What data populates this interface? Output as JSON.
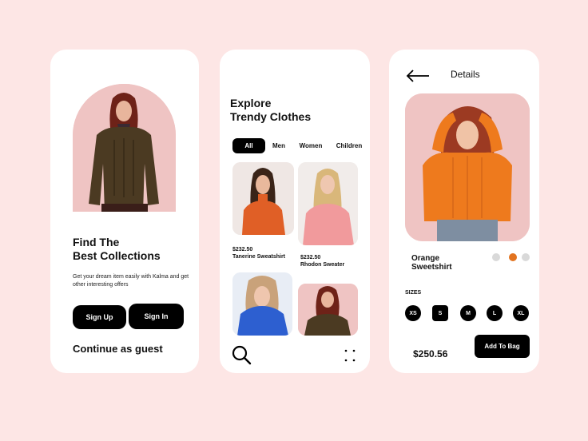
{
  "welcome": {
    "title_line1": "Find The",
    "title_line2": "Best Collections",
    "description": "Get your dream item easily with Kalma and get other interesting offers",
    "sign_up_label": "Sign Up",
    "sign_in_label": "Sign In",
    "guest_label": "Continue as guest"
  },
  "explore": {
    "title_line1": "Explore",
    "title_line2": "Trendy Clothes",
    "tabs": [
      {
        "label": "All",
        "active": true
      },
      {
        "label": "Men",
        "active": false
      },
      {
        "label": "Women",
        "active": false
      },
      {
        "label": "Children",
        "active": false
      }
    ],
    "products": [
      {
        "price": "$232.50",
        "name": "Tanerine Sweatshirt"
      },
      {
        "price": "$232.50",
        "name": "Rhodon Sweater"
      }
    ],
    "bottom_nav": {
      "search_icon": "search-icon",
      "menu_icon": "grid-dots-icon"
    }
  },
  "details": {
    "header": "Details",
    "back_icon": "arrow-left-icon",
    "product_name_line1": "Orange",
    "product_name_line2": "Sweetshirt",
    "colors": [
      "#d9d9d9",
      "#e2731f",
      "#d9d9d9"
    ],
    "sizes_label": "SIZES",
    "sizes": [
      "XS",
      "S",
      "M",
      "L",
      "XL"
    ],
    "price": "$250.56",
    "add_to_bag_label": "Add To Bag"
  }
}
